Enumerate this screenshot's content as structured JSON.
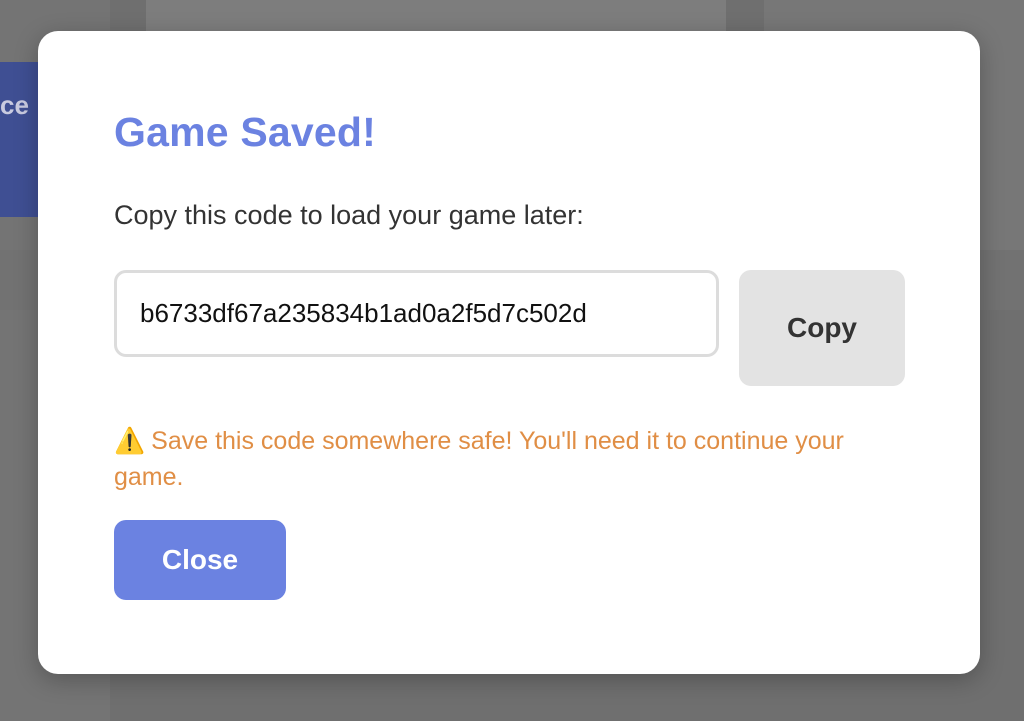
{
  "background": {
    "button_text": "ce"
  },
  "modal": {
    "title": "Game Saved!",
    "instruction": "Copy this code to load your game later:",
    "code_value": "b6733df67a235834b1ad0a2f5d7c502d",
    "copy_label": "Copy",
    "warning_icon": "⚠️",
    "warning_text": "Save this code somewhere safe! You'll need it to continue your game.",
    "close_label": "Close"
  },
  "colors": {
    "accent": "#6b82e1",
    "warning": "#e08e45",
    "overlay": "#6f6f6f"
  }
}
